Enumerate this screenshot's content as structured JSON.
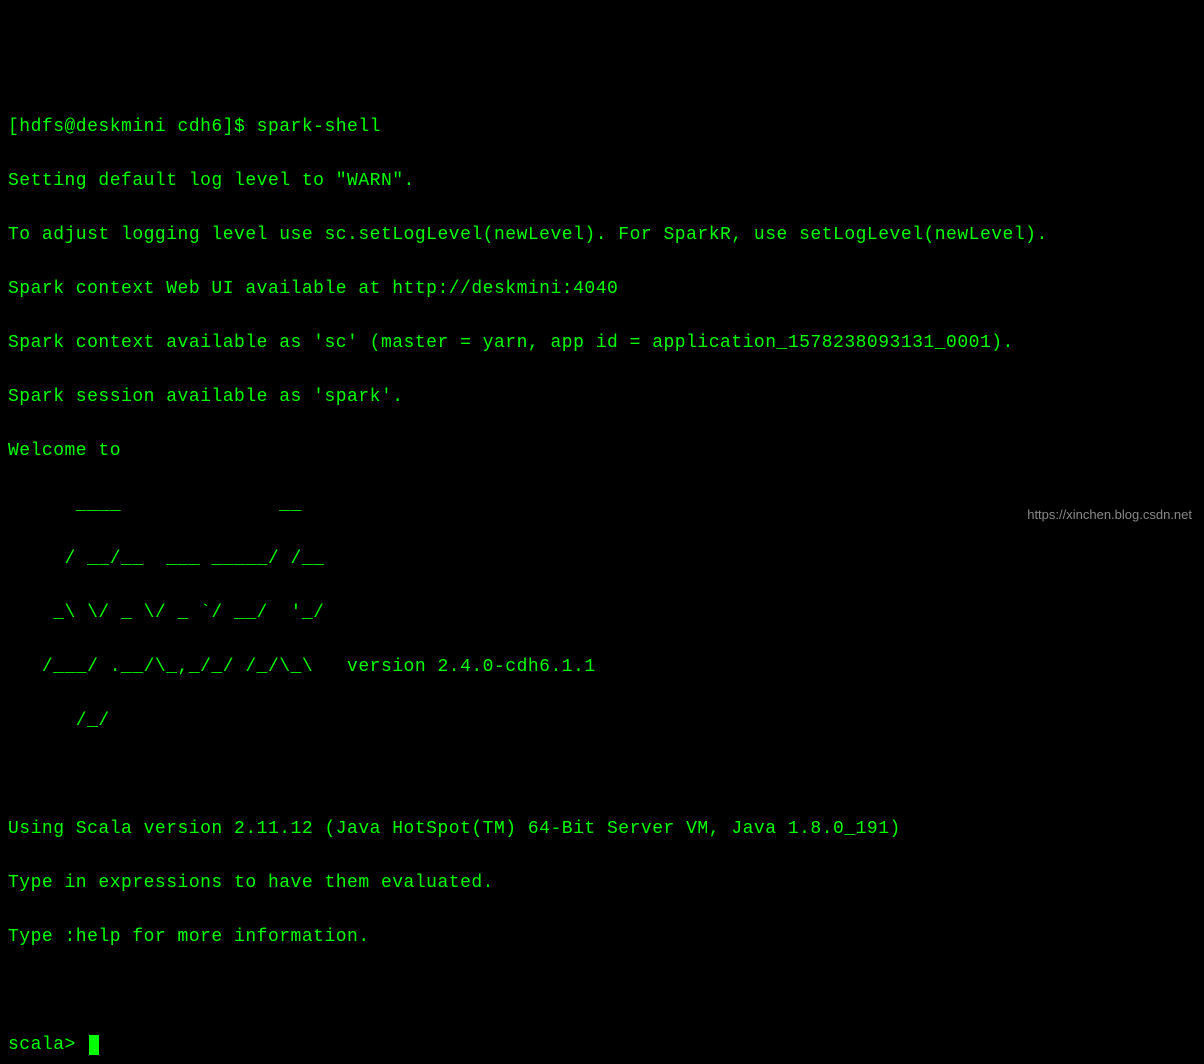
{
  "prompt": {
    "line1_prefix": "[hdfs@deskmini cdh6]$ ",
    "command": "spark-shell"
  },
  "output": {
    "line1": "Setting default log level to \"WARN\".",
    "line2": "To adjust logging level use sc.setLogLevel(newLevel). For SparkR, use setLogLevel(newLevel).",
    "line3": "Spark context Web UI available at http://deskmini:4040",
    "line4": "Spark context available as 'sc' (master = yarn, app id = application_1578238093131_0001).",
    "line5": "Spark session available as 'spark'.",
    "line6": "Welcome to"
  },
  "ascii_art": {
    "l1": "      ____              __",
    "l2": "     / __/__  ___ _____/ /__",
    "l3": "    _\\ \\/ _ \\/ _ `/ __/  '_/",
    "l4": "   /___/ .__/\\_,_/_/ /_/\\_\\   version 2.4.0-cdh6.1.1",
    "l5": "      /_/"
  },
  "footer": {
    "line1": "Using Scala version 2.11.12 (Java HotSpot(TM) 64-Bit Server VM, Java 1.8.0_191)",
    "line2": "Type in expressions to have them evaluated.",
    "line3": "Type :help for more information."
  },
  "scala_prompt": "scala> ",
  "watermark": "https://xinchen.blog.csdn.net"
}
